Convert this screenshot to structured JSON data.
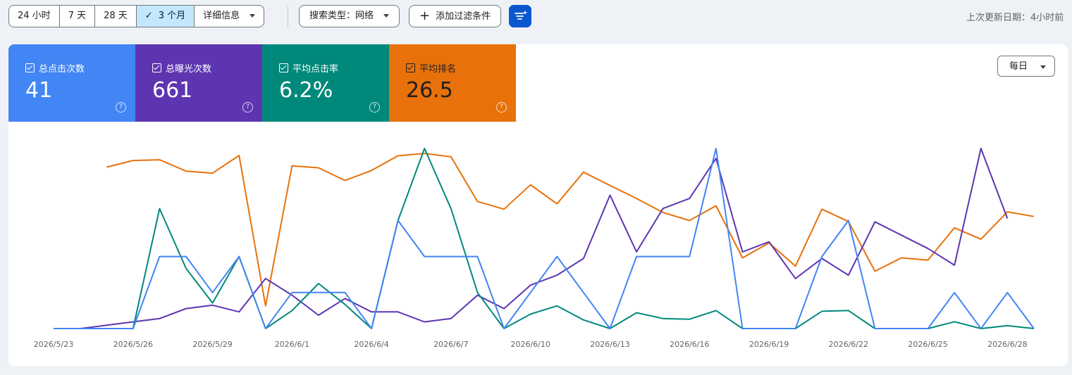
{
  "toolbar": {
    "range_tabs": [
      {
        "label": "24 小时",
        "active": false
      },
      {
        "label": "7 天",
        "active": false
      },
      {
        "label": "28 天",
        "active": false
      },
      {
        "label": "3 个月",
        "active": true
      },
      {
        "label": "详细信息",
        "active": false
      }
    ],
    "search_type": "搜索类型：网络",
    "add_filter": "添加过滤条件",
    "last_updated": "上次更新日期：4小时前"
  },
  "metrics": [
    {
      "label": "总点击次数",
      "value": "41",
      "color": "#4285f4"
    },
    {
      "label": "总曝光次数",
      "value": "661",
      "color": "#5e35b1"
    },
    {
      "label": "平均点击率",
      "value": "6.2%",
      "color": "#00897b"
    },
    {
      "label": "平均排名",
      "value": "26.5",
      "color": "#e8710a"
    }
  ],
  "granularity": "每日",
  "chart_data": {
    "type": "line",
    "x": [
      "2026/5/23",
      "2026/5/24",
      "2026/5/25",
      "2026/5/26",
      "2026/5/27",
      "2026/5/28",
      "2026/5/29",
      "2026/5/30",
      "2026/5/31",
      "2026/6/1",
      "2026/6/2",
      "2026/6/3",
      "2026/6/4",
      "2026/6/5",
      "2026/6/6",
      "2026/6/7",
      "2026/6/8",
      "2026/6/9",
      "2026/6/10",
      "2026/6/11",
      "2026/6/12",
      "2026/6/13",
      "2026/6/14",
      "2026/6/15",
      "2026/6/16",
      "2026/6/17",
      "2026/6/18",
      "2026/6/19",
      "2026/6/20",
      "2026/6/21",
      "2026/6/22",
      "2026/6/23",
      "2026/6/24",
      "2026/6/25",
      "2026/6/26",
      "2026/6/27",
      "2026/6/28",
      "2026/6/29"
    ],
    "xtick_labels": [
      "2026/5/23",
      "2026/5/26",
      "2026/5/29",
      "2026/6/1",
      "2026/6/4",
      "2026/6/7",
      "2026/6/10",
      "2026/6/13",
      "2026/6/16",
      "2026/6/19",
      "2026/6/22",
      "2026/6/25",
      "2026/6/28"
    ],
    "series": [
      {
        "name": "平均排名",
        "color": "#e8710a",
        "values": [
          null,
          null,
          21.6,
          19.6,
          19.4,
          22.8,
          23.4,
          18.1,
          63.2,
          21.2,
          21.8,
          25.6,
          22.6,
          18.2,
          17.5,
          18.5,
          31.9,
          34.2,
          26.9,
          32.6,
          23.1,
          27.1,
          31.0,
          35.2,
          37.6,
          33.2,
          48.8,
          44.3,
          51.3,
          34.2,
          37.9,
          52.8,
          48.8,
          49.5,
          39.8,
          43.2,
          35.0,
          36.4
        ]
      },
      {
        "name": "总曝光次数",
        "color": "#5e35b1",
        "values": [
          0,
          0,
          1,
          2,
          3,
          6,
          7,
          5,
          15,
          10,
          4,
          9,
          5,
          5,
          2,
          3,
          10,
          6,
          13,
          16,
          21,
          40,
          23,
          36,
          39,
          51,
          23,
          26,
          15,
          21,
          16,
          32,
          28,
          24,
          19,
          54,
          33,
          null
        ]
      },
      {
        "name": "平均点击率",
        "color": "#00897b",
        "values": [
          0,
          0,
          0,
          0,
          33.3,
          16.7,
          7.1,
          20,
          0,
          5,
          12.5,
          6.7,
          0,
          30,
          50,
          33.3,
          10,
          0,
          4,
          6.3,
          2.4,
          0,
          4.4,
          2.8,
          2.6,
          5,
          0,
          0,
          0,
          4.8,
          5,
          0,
          0,
          0,
          1.9,
          0,
          0.8,
          0
        ]
      },
      {
        "name": "总点击次数",
        "color": "#4285f4",
        "values": [
          0,
          0,
          0,
          0,
          2,
          2,
          1,
          2,
          0,
          1,
          1,
          1,
          0,
          3,
          2,
          2,
          2,
          0,
          1,
          2,
          1,
          0,
          2,
          2,
          2,
          5,
          0,
          0,
          0,
          2,
          3,
          0,
          0,
          0,
          1,
          0,
          1,
          0
        ]
      }
    ]
  }
}
